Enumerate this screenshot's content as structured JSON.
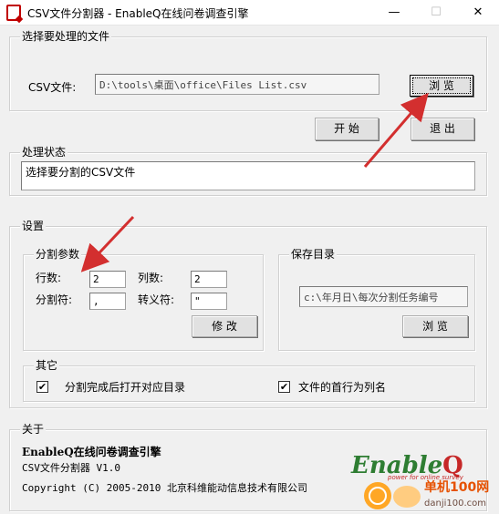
{
  "window": {
    "title": "CSV文件分割器 - EnableQ在线问卷调查引擎",
    "minimize": "—",
    "maximize": "☐",
    "close": "✕"
  },
  "file_group": {
    "legend": "选择要处理的文件",
    "csv_label": "CSV文件:",
    "csv_path": "D:\\tools\\桌面\\office\\Files List.csv",
    "browse_label": "浏  览"
  },
  "actions": {
    "start_label": "开  始",
    "exit_label": "退  出"
  },
  "status_group": {
    "legend": "处理状态",
    "message": "选择要分割的CSV文件"
  },
  "settings": {
    "legend": "设置",
    "split_params": {
      "legend": "分割参数",
      "rows_label": "行数:",
      "rows_value": "2",
      "cols_label": "列数:",
      "cols_value": "2",
      "sep_label": "分割符:",
      "sep_value": ",",
      "escape_label": "转义符:",
      "escape_value": "\"",
      "modify_label": "修  改"
    },
    "save_dir": {
      "legend": "保存目录",
      "path": "c:\\年月日\\每次分割任务编号",
      "browse_label": "浏  览"
    },
    "other": {
      "legend": "其它",
      "open_dir_label": "分割完成后打开对应目录",
      "open_dir_checked": true,
      "header_row_label": "文件的首行为列名",
      "header_row_checked": true
    }
  },
  "about": {
    "legend": "关于",
    "product": "EnableQ在线问卷调查引擎",
    "version_line": "CSV文件分割器  V1.0",
    "copyright": "Copyright (C) 2005-2010 北京科维能动信息技术有限公司",
    "logo_text": "Enable",
    "logo_mark": "Q",
    "logo_tagline": "power for online survey",
    "watermark_site": "单机100网",
    "watermark_url": "danji100.com"
  },
  "colors": {
    "arrow": "#d32f2f",
    "logo_green": "#2e7d32",
    "logo_red": "#c62828"
  }
}
